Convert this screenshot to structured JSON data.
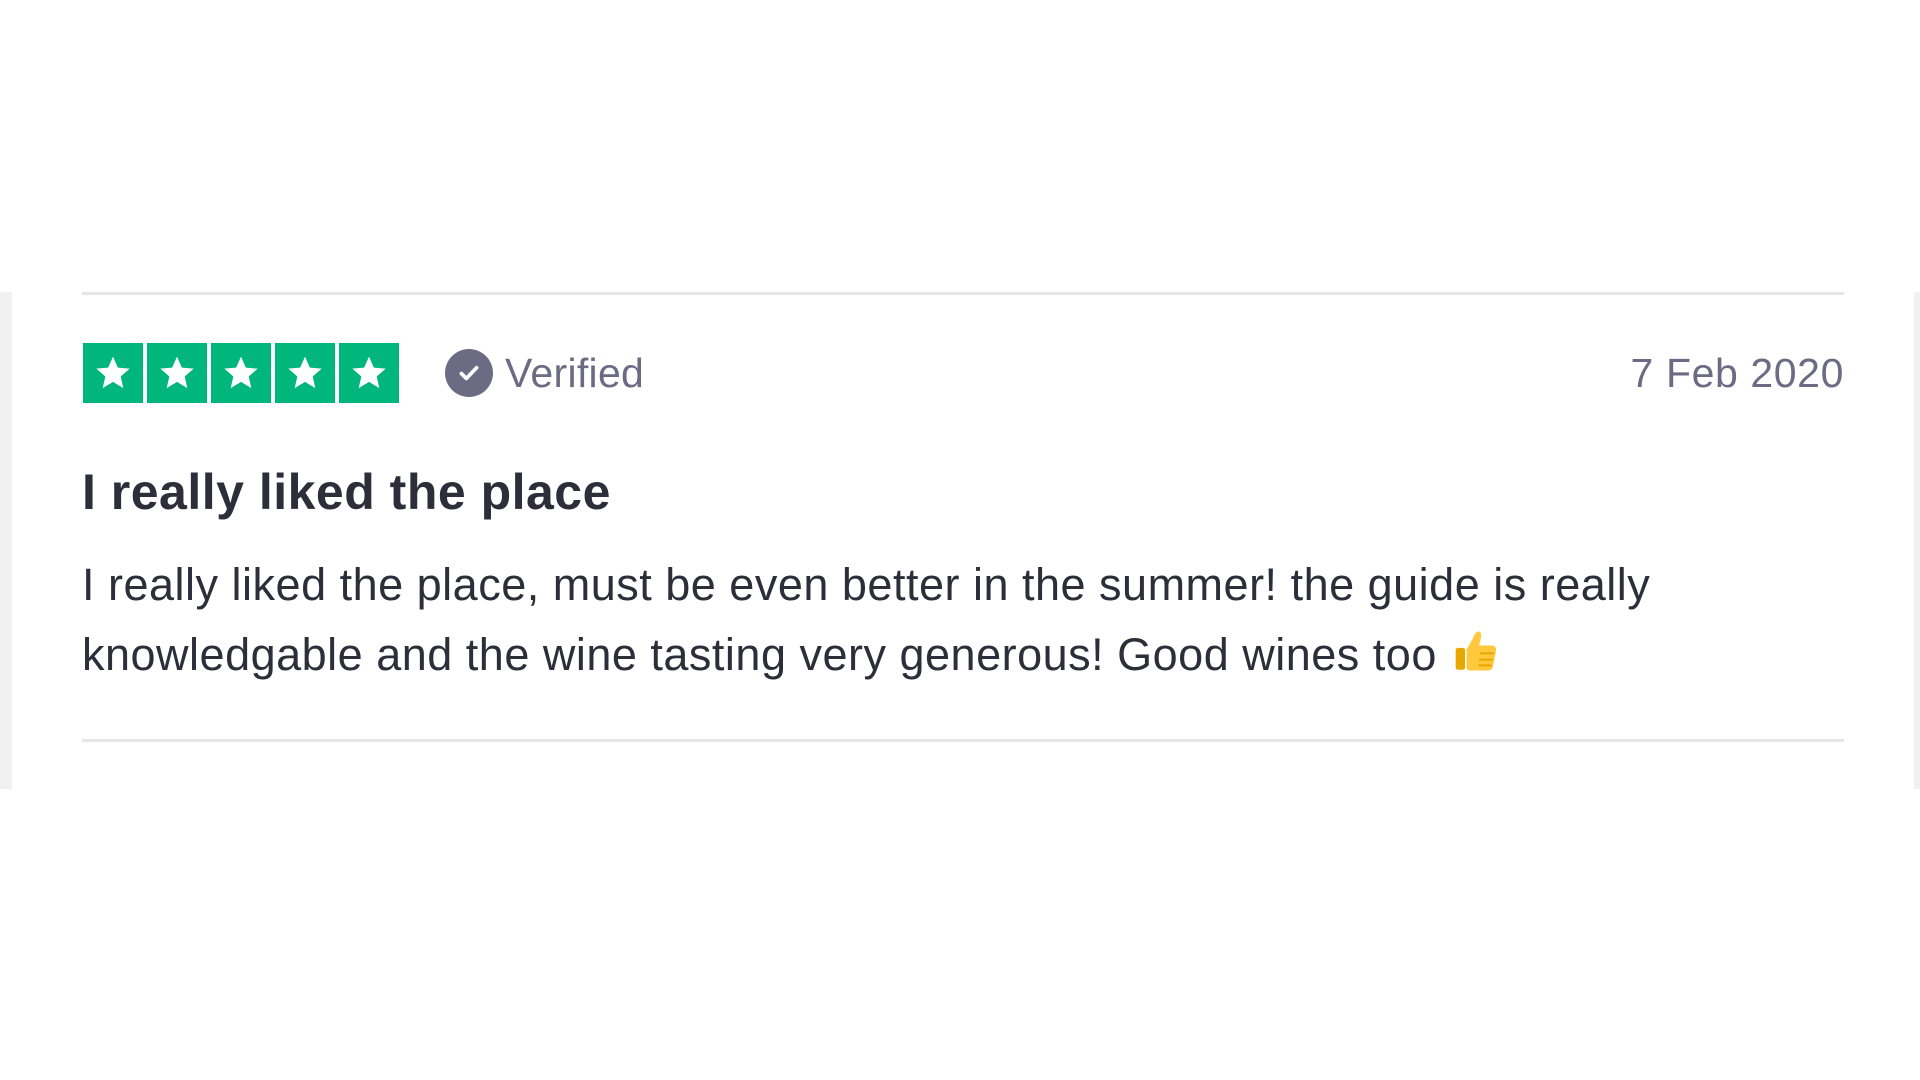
{
  "review": {
    "rating": 5,
    "rating_max": 5,
    "star_color": "#00b67a",
    "verified_label": "Verified",
    "date": "7 Feb 2020",
    "title": "I really liked the place",
    "body": "I really liked the place, must be even better in the summer! the guide is really knowledgable and the wine tasting very generous! Good wines too",
    "body_emoji_icon": "thumbs-up-icon"
  },
  "colors": {
    "text_primary": "#2e2e3a",
    "text_muted": "#6b6b84",
    "divider": "#e6e6ea"
  }
}
